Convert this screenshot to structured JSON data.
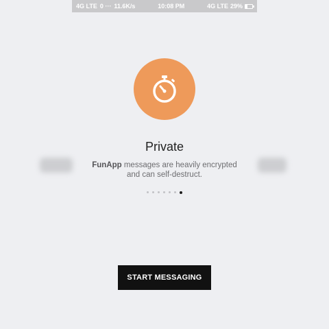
{
  "status_bar": {
    "left_network": "4G LTE",
    "left_extra": "0 ···",
    "speed": "11.6K/s",
    "time": "10:08 PM",
    "right_network": "4G LTE",
    "battery": "29%",
    "battery_level": 0.29
  },
  "onboarding": {
    "hero_icon": "stopwatch-icon",
    "hero_color": "#ee9a5a",
    "title": "Private",
    "desc_app": "FunApp",
    "desc_line1_rest": " messages are heavily encrypted",
    "desc_line2": "and can self-destruct.",
    "pager": {
      "count": 7,
      "active_index": 6
    }
  },
  "actions": {
    "start_label": "START MESSAGING"
  }
}
